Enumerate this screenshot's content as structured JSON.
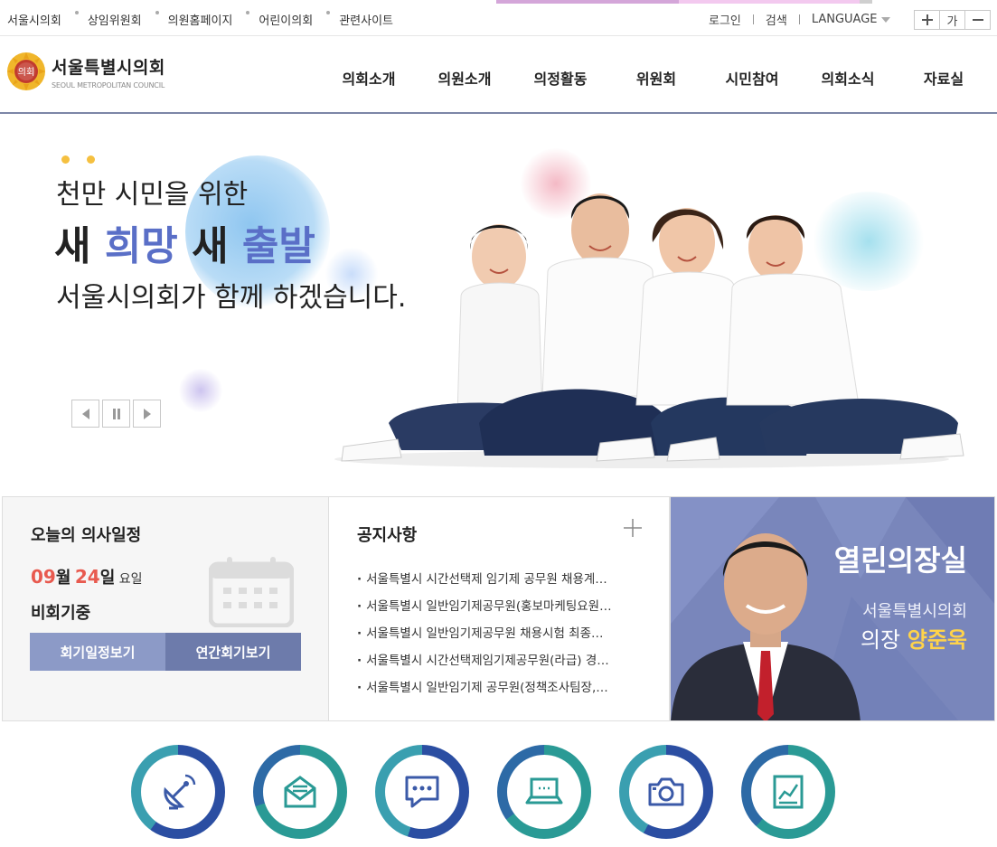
{
  "top_links": [
    "서울시의회",
    "상임위원회",
    "의원홈페이지",
    "어린이의회",
    "관련사이트"
  ],
  "utils": {
    "login": "로그인",
    "search": "검색",
    "language": "LANGUAGE"
  },
  "font_control": {
    "increase": "+",
    "current": "가",
    "decrease": "−"
  },
  "logo": {
    "korean": "서울특별시의회",
    "english": "SEOUL METROPOLITAN COUNCIL",
    "emblem_text": "의회"
  },
  "nav": [
    "의회소개",
    "의원소개",
    "의정활동",
    "위원회",
    "시민참여",
    "의회소식",
    "자료실"
  ],
  "hero": {
    "line1": "천만 시민을 위한",
    "line2_a": "새 ",
    "line2_b": "희망",
    "line2_c": " 새 ",
    "line2_d": "출발",
    "line3": "서울시의회가 함께 하겠습니다."
  },
  "schedule": {
    "title": "오늘의 의사일정",
    "month": "09",
    "month_unit": "월",
    "day": "24",
    "day_unit": "일",
    "weekday": "요일",
    "status": "비회기중",
    "btn_schedule": "회기일정보기",
    "btn_annual": "연간회기보기"
  },
  "notice": {
    "title": "공지사항",
    "items": [
      "서울특별시 시간선택제 임기제 공무원 채용계…",
      "서울특별시 일반임기제공무원(홍보마케팅요원…",
      "서울특별시 일반임기제공무원 채용시험 최종…",
      "서울특별시 시간선택제임기제공무원(라급) 경…",
      "서울특별시 일반임기제 공무원(정책조사팀장,…"
    ]
  },
  "chair": {
    "title": "열린의장실",
    "org": "서울특별시의회",
    "role": "의장",
    "name": "양준욱"
  },
  "colors": {
    "accent_blue": "#5a6fc7",
    "date_red": "#e85a4f",
    "chair_bg": "#7986bb",
    "name_gold": "#ffd34a"
  },
  "quick_menu_icons": [
    "satellite-dish-icon",
    "envelope-icon",
    "chat-bubble-icon",
    "laptop-icon",
    "camera-icon",
    "chart-board-icon"
  ]
}
